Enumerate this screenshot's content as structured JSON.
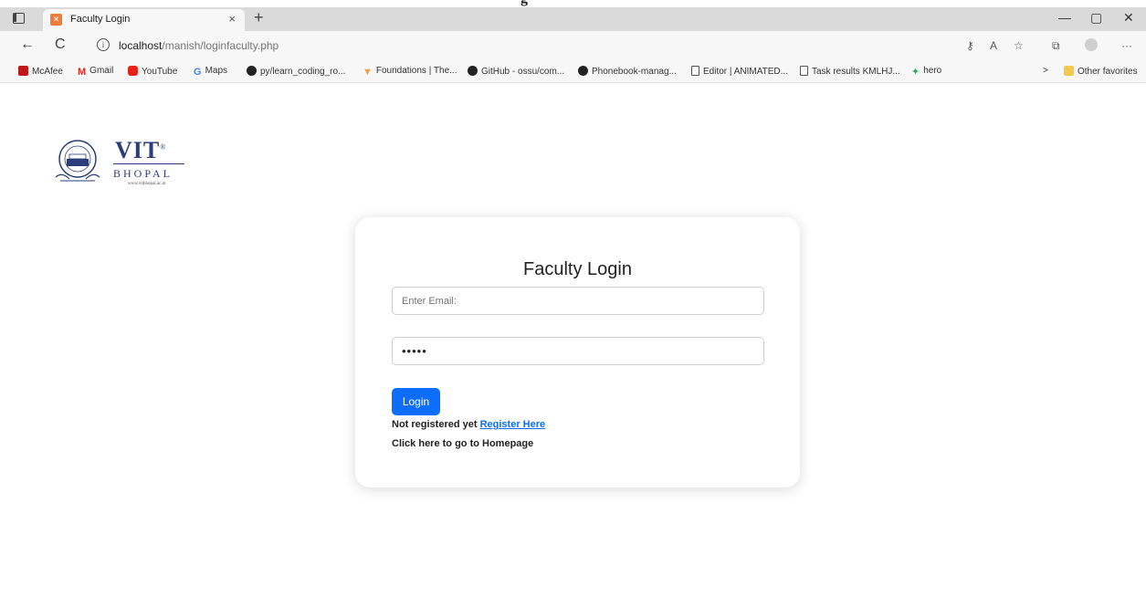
{
  "browser": {
    "tab_title": "Faculty Login",
    "tab_close": "×",
    "new_tab": "+",
    "minimize": "—",
    "maximize": "▢",
    "close": "✕",
    "back": "←",
    "refresh": "C",
    "url_host": "localhost",
    "url_path": "/manish/loginfaculty.php",
    "bookmarks": [
      {
        "label": "McAfee",
        "icon": "mcafee-icon"
      },
      {
        "label": "Gmail",
        "icon": "gmail-icon"
      },
      {
        "label": "YouTube",
        "icon": "youtube-icon"
      },
      {
        "label": "Maps",
        "icon": "google-icon"
      },
      {
        "label": "py/learn_coding_ro...",
        "icon": "github-icon"
      },
      {
        "label": "Foundations | The...",
        "icon": "foundations-icon"
      },
      {
        "label": "GitHub - ossu/com...",
        "icon": "github-icon"
      },
      {
        "label": "Phonebook-manag...",
        "icon": "github-icon"
      },
      {
        "label": "Editor | ANIMATED...",
        "icon": "page-icon"
      },
      {
        "label": "Task results KMLHJ...",
        "icon": "page-icon"
      },
      {
        "label": "hero",
        "icon": "hero-icon"
      }
    ],
    "other_favorites": "Other favorites"
  },
  "logo": {
    "name": "VIT",
    "campus": "BHOPAL",
    "site": "www.vitbhopal.ac.in"
  },
  "login": {
    "title": "Faculty Login",
    "email_placeholder": "Enter Email:",
    "password_value": "•••••",
    "login_label": "Login",
    "not_registered": "Not registered yet ",
    "register_link": "Register Here",
    "homepage_text": "Click here to go to Homepage"
  }
}
